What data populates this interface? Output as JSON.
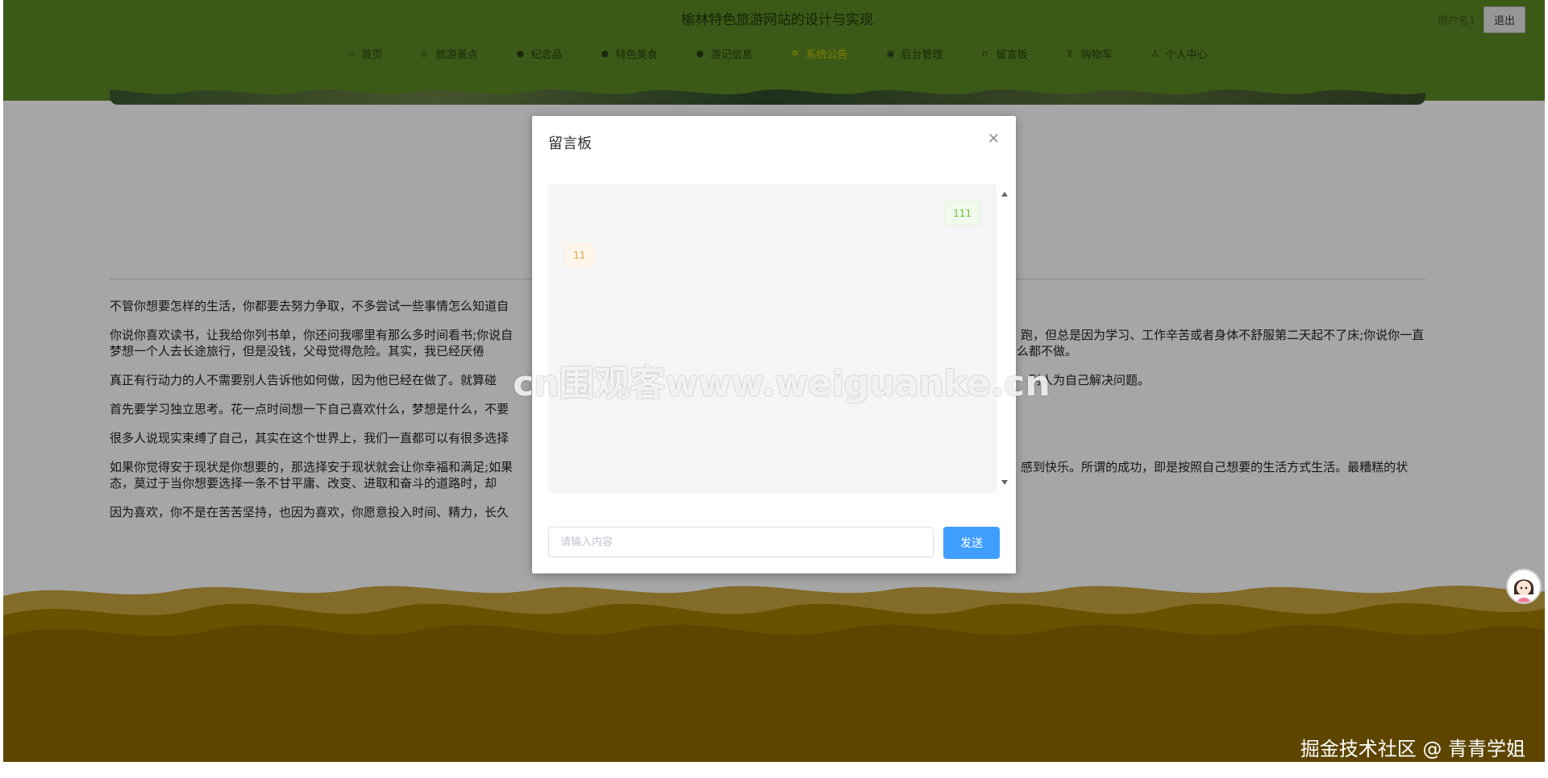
{
  "header": {
    "title": "榆林特色旅游网站的设计与实现",
    "username": "用户名1",
    "logout_label": "退出",
    "nav": [
      {
        "label": "首页",
        "icon": "star-icon",
        "active": false
      },
      {
        "label": "旅游景点",
        "icon": "bag-icon",
        "active": false
      },
      {
        "label": "纪念品",
        "icon": "circle-icon",
        "active": false
      },
      {
        "label": "特色美食",
        "icon": "circle-icon",
        "active": false
      },
      {
        "label": "游记信息",
        "icon": "info-icon",
        "active": false
      },
      {
        "label": "系统公告",
        "icon": "gear-icon",
        "active": true
      },
      {
        "label": "后台管理",
        "icon": "calendar-icon",
        "active": false
      },
      {
        "label": "留言板",
        "icon": "headset-icon",
        "active": false
      },
      {
        "label": "购物车",
        "icon": "cart-icon",
        "active": false
      },
      {
        "label": "个人中心",
        "icon": "user-icon",
        "active": false
      }
    ]
  },
  "article": {
    "paragraphs": [
      "不管你想要怎样的生活，你都要去努力争取，不多尝试一些事情怎么知道自",
      "你说你喜欢读书，让我给你列书单，你还问我哪里有那么多时间看书;你说自　　　　　　　　　　　　　　　　　　　　　　　　　　　　　　　　　　　　　　　　　　跑，但总是因为学习、工作辛苦或者身体不舒服第二天起不了床;你说你一直梦想一个人去长途旅行，但是没钱，父母觉得危险。其实，我已经厌倦　　　　　　　　　　　　　　　　　　　　　　　　　　　　　　　　　　　　　　　　　　本什么都不做。",
      "真正有行动力的人不需要别人告诉他如何做，因为他已经在做了。就算碰　　　　　　　　　　　　　　　　　　　　　　　　　　　　　　　　　　　　　　　　　　　　别人为自己解决问题。",
      "首先要学习独立思考。花一点时间想一下自己喜欢什么，梦想是什么，不要",
      "很多人说现实束缚了自己，其实在这个世界上，我们一直都可以有很多选择",
      "如果你觉得安于现状是你想要的，那选择安于现状就会让你幸福和满足;如果　　　　　　　　　　　　　　　　　　　　　　　　　　　　　　　　　　　　　　　　　　感到快乐。所谓的成功，即是按照自己想要的生活方式生活。最糟糕的状态，莫过于当你想要选择一条不甘平庸、改变、进取和奋斗的道路时，却",
      "因为喜欢，你不是在苦苦坚持，也因为喜欢，你愿意投入时间、精力，长久"
    ]
  },
  "modal": {
    "title": "留言板",
    "messages": [
      {
        "text": "111",
        "side": "right"
      },
      {
        "text": "11",
        "side": "left"
      }
    ],
    "input_placeholder": "请输入内容",
    "input_value": "",
    "send_label": "发送"
  },
  "watermarks": {
    "center": "cn围观客www.weiguanke.cn",
    "footer": "掘金技术社区 @ 青青学姐"
  },
  "colors": {
    "header_green": "#5b8b24",
    "footer_gold": "#8f6b00",
    "send_blue": "#409eff",
    "active_nav": "#c6c400"
  }
}
